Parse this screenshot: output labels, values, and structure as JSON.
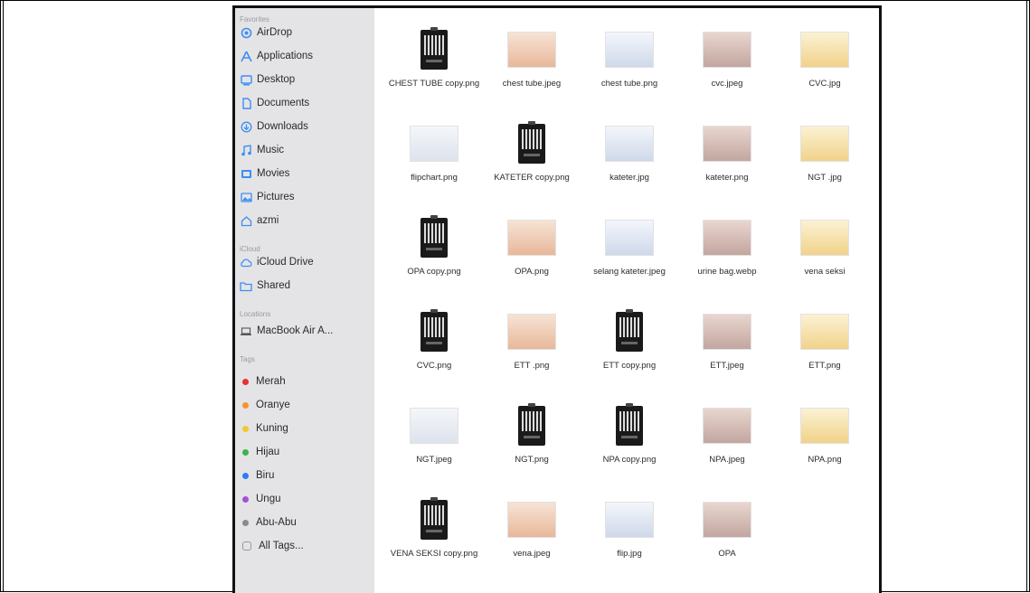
{
  "sidebar": {
    "sections": {
      "favorites": "Favorites",
      "icloud": "iCloud",
      "locations": "Locations",
      "tags": "Tags"
    },
    "favorites": [
      {
        "label": "AirDrop",
        "icon": "airdrop-icon"
      },
      {
        "label": "Applications",
        "icon": "applications-icon"
      },
      {
        "label": "Desktop",
        "icon": "desktop-icon"
      },
      {
        "label": "Documents",
        "icon": "document-icon"
      },
      {
        "label": "Downloads",
        "icon": "download-icon"
      },
      {
        "label": "Music",
        "icon": "music-icon"
      },
      {
        "label": "Movies",
        "icon": "movies-icon"
      },
      {
        "label": "Pictures",
        "icon": "pictures-icon"
      },
      {
        "label": "azmi",
        "icon": "home-icon"
      }
    ],
    "icloud": [
      {
        "label": "iCloud Drive",
        "icon": "cloud-icon"
      },
      {
        "label": "Shared",
        "icon": "shared-folder-icon"
      }
    ],
    "locations": [
      {
        "label": "MacBook Air A...",
        "icon": "laptop-icon"
      }
    ],
    "tags": [
      {
        "label": "Merah",
        "color": "#e8312f"
      },
      {
        "label": "Oranye",
        "color": "#f2962b"
      },
      {
        "label": "Kuning",
        "color": "#f4c630"
      },
      {
        "label": "Hijau",
        "color": "#3cb44a"
      },
      {
        "label": "Biru",
        "color": "#2f7bf2"
      },
      {
        "label": "Ungu",
        "color": "#a350d6"
      },
      {
        "label": "Abu-Abu",
        "color": "#8a8a8a"
      },
      {
        "label": "All Tags...",
        "color": "none"
      }
    ]
  },
  "files": [
    {
      "name": "CHEST TUBE copy.png",
      "kind": "qr"
    },
    {
      "name": "chest tube.jpeg",
      "kind": "image"
    },
    {
      "name": "chest tube.png",
      "kind": "image"
    },
    {
      "name": "cvc.jpeg",
      "kind": "image"
    },
    {
      "name": "CVC.jpg",
      "kind": "image"
    },
    {
      "name": "flipchart.png",
      "kind": "image"
    },
    {
      "name": "KATETER copy.png",
      "kind": "qr"
    },
    {
      "name": "kateter.jpg",
      "kind": "image"
    },
    {
      "name": "kateter.png",
      "kind": "image"
    },
    {
      "name": "NGT .jpg",
      "kind": "image"
    },
    {
      "name": "OPA copy.png",
      "kind": "qr"
    },
    {
      "name": "OPA.png",
      "kind": "image"
    },
    {
      "name": "selang kateter.jpeg",
      "kind": "image"
    },
    {
      "name": "urine bag.webp",
      "kind": "image"
    },
    {
      "name": "vena seksi",
      "kind": "image"
    },
    {
      "name": "CVC.png",
      "kind": "qr"
    },
    {
      "name": "ETT .png",
      "kind": "image"
    },
    {
      "name": "ETT copy.png",
      "kind": "qr"
    },
    {
      "name": "ETT.jpeg",
      "kind": "image"
    },
    {
      "name": "ETT.png",
      "kind": "image"
    },
    {
      "name": "NGT.jpeg",
      "kind": "image"
    },
    {
      "name": "NGT.png",
      "kind": "qr"
    },
    {
      "name": "NPA copy.png",
      "kind": "qr"
    },
    {
      "name": "NPA.jpeg",
      "kind": "image"
    },
    {
      "name": "NPA.png",
      "kind": "image"
    },
    {
      "name": "VENA SEKSI copy.png",
      "kind": "qr"
    },
    {
      "name": "vena.jpeg",
      "kind": "image"
    },
    {
      "name": "flip.jpg",
      "kind": "image"
    },
    {
      "name": "OPA",
      "kind": "image"
    }
  ]
}
